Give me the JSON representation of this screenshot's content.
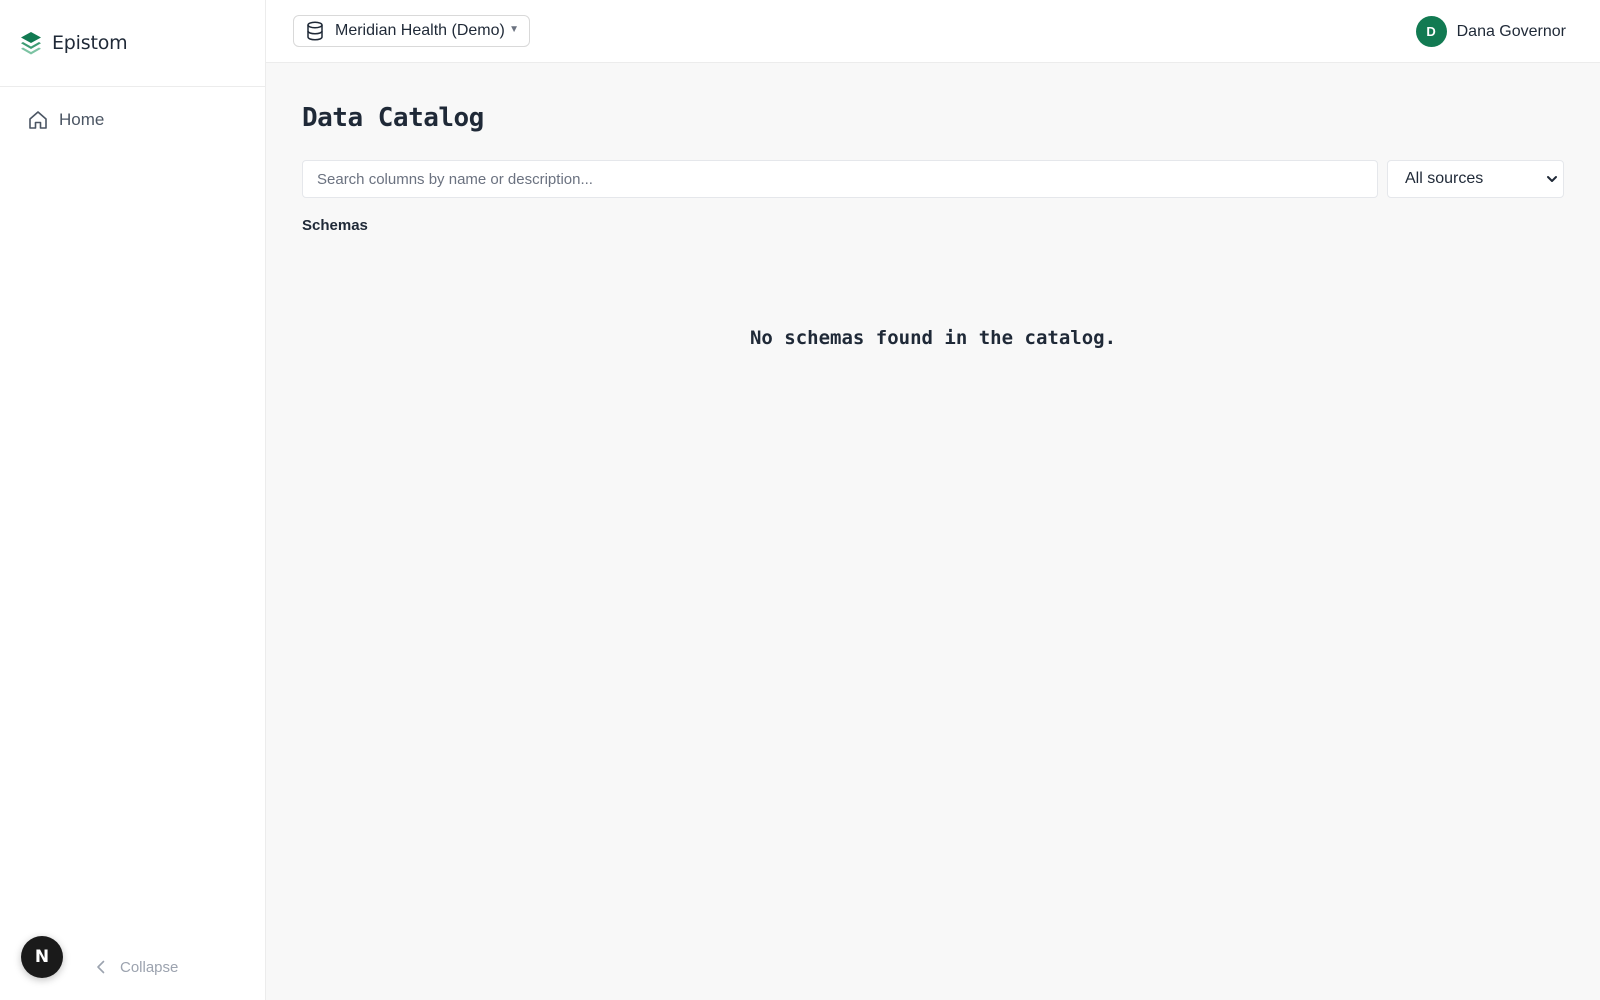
{
  "app": {
    "name": "Epistom"
  },
  "sidebar": {
    "items": [
      {
        "label": "Home",
        "icon": "home-icon"
      }
    ],
    "collapse_label": "Collapse",
    "badge_letter": "N"
  },
  "topbar": {
    "database": {
      "label": "Meridian Health (Demo)",
      "icon": "database-icon"
    },
    "user": {
      "initial": "D",
      "name": "Dana Governor",
      "avatar_color": "#127a52"
    }
  },
  "main": {
    "title": "Data Catalog",
    "search": {
      "placeholder": "Search columns by name or description...",
      "value": ""
    },
    "source_filter": {
      "selected": "All sources"
    },
    "section_label": "Schemas",
    "empty_message": "No schemas found in the catalog."
  },
  "colors": {
    "brand_green": "#127a52",
    "background": "#f8f8f8"
  }
}
